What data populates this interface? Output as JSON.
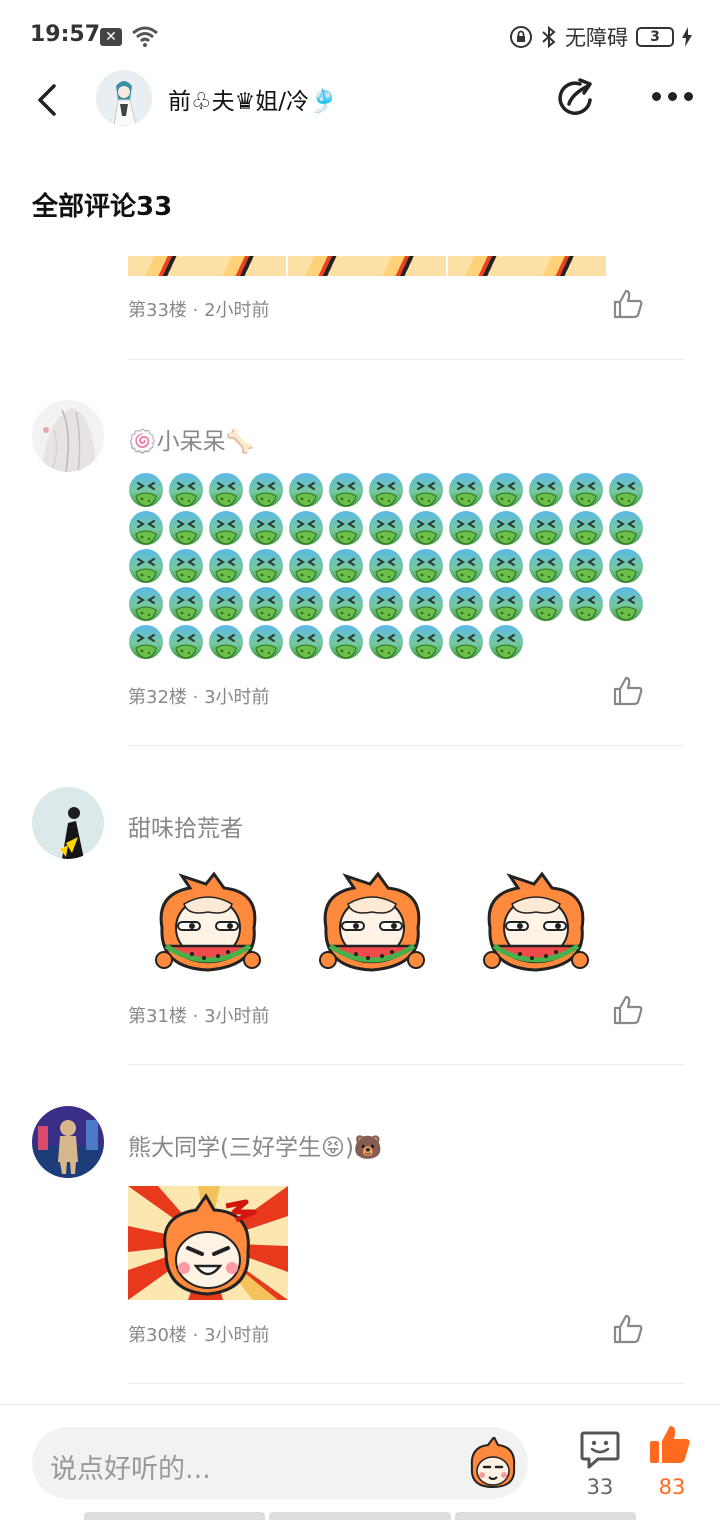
{
  "status_bar": {
    "time": "19:57",
    "notification_icon": "x-badge-icon",
    "accessibility": "无障碍",
    "battery": "3"
  },
  "header": {
    "title": "前♧夫♛姐/冷🎐"
  },
  "section": {
    "title": "全部评论33"
  },
  "comments": [
    {
      "meta": "第33楼 · 2小时前"
    },
    {
      "username": "🍥小呆呆🦴",
      "meta": "第32楼 · 3小时前",
      "emoji_count": 62,
      "emoji": "nauseated-face-icon"
    },
    {
      "username": "甜味拾荒者",
      "meta": "第31楼 · 3小时前",
      "stickers": 3
    },
    {
      "username": "熊大同学(三好学生😝)🐻",
      "meta": "第30楼 · 3小时前"
    }
  ],
  "bottom_bar": {
    "placeholder": "说点好听的...",
    "comment_count": "33",
    "like_count": "83"
  },
  "colors": {
    "accent": "#ff6a1f",
    "meta_text": "#888888",
    "divider": "#ececec",
    "input_bg": "#f2f2f2"
  }
}
